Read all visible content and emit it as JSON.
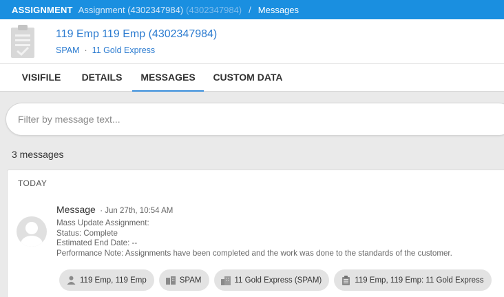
{
  "breadcrumb": {
    "root": "ASSIGNMENT",
    "assignment": "Assignment (4302347984)",
    "assignment_id_ghost": "(4302347984)",
    "separator": "/",
    "current": "Messages"
  },
  "header": {
    "title": "119 Emp 119 Emp (4302347984)",
    "subtitle_left": "SPAM",
    "subtitle_sep": "·",
    "subtitle_right": "11 Gold Express",
    "icon": "clipboard-check-icon"
  },
  "tabs": [
    {
      "label": "VISIFILE",
      "active": false
    },
    {
      "label": "DETAILS",
      "active": false
    },
    {
      "label": "MESSAGES",
      "active": true
    },
    {
      "label": "CUSTOM DATA",
      "active": false
    }
  ],
  "filter": {
    "placeholder": "Filter by message text...",
    "value": ""
  },
  "message_count": "3 messages",
  "group": {
    "day_label": "TODAY",
    "message": {
      "title": "Message",
      "time": "· Jun 27th, 10:54 AM",
      "lines": [
        "Mass Update Assignment:",
        "Status: Complete",
        "Estimated End Date: --",
        "Performance Note: Assignments have been completed and the work was done to the standards of the customer."
      ],
      "chips": [
        {
          "label": "119 Emp, 119 Emp",
          "icon": "person-icon"
        },
        {
          "label": "SPAM",
          "icon": "building-icon"
        },
        {
          "label": "11 Gold Express (SPAM)",
          "icon": "buildings-icon"
        },
        {
          "label": "119 Emp, 119 Emp: 11 Gold Express",
          "icon": "clipboard-icon"
        }
      ]
    }
  },
  "colors": {
    "topbar": "#1a8fe0",
    "link": "#2b7bd0",
    "active_tab_underline": "#3a8edb",
    "chip_bg": "#e3e3e3"
  }
}
